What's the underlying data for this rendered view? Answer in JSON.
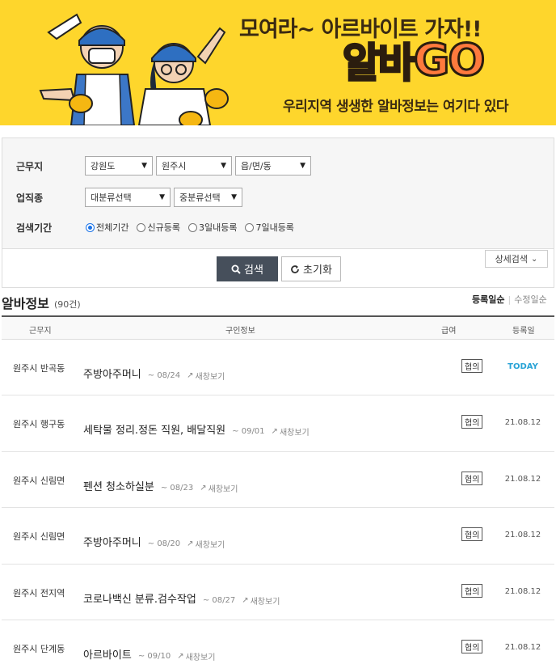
{
  "banner": {
    "slogan": "모여라~ 아르바이트 가자!!",
    "logo_kr": "알바",
    "logo_en": "GO",
    "tagline": "우리지역 생생한 알바정보는 여기다 있다"
  },
  "search": {
    "work_area_label": "근무지",
    "province": "강원도",
    "city": "원주시",
    "town": "읍/면/동",
    "job_type_label": "업직종",
    "major_category": "대분류선택",
    "minor_category": "중분류선택",
    "period_label": "검색기간",
    "period_options": [
      "전체기간",
      "신규등록",
      "3일내등록",
      "7일내등록"
    ],
    "period_selected": 0,
    "detail_search": "상세검색",
    "search_button": "검색",
    "reset_button": "초기화"
  },
  "list": {
    "title": "알바정보",
    "count": "(90건)",
    "sort_registered": "등록일순",
    "sort_modified": "수정일순",
    "columns": [
      "근무지",
      "구인정보",
      "급여",
      "등록일"
    ],
    "new_window_label": "새창보기",
    "rows": [
      {
        "area": "원주시 반곡동",
        "job": "주방아주머니",
        "deadline": "~ 08/24",
        "pay": "협의",
        "date": "TODAY"
      },
      {
        "area": "원주시 행구동",
        "job": "세탁물 정리.정돈 직원, 배달직원",
        "deadline": "~ 09/01",
        "pay": "협의",
        "date": "21.08.12"
      },
      {
        "area": "원주시 신림면",
        "job": "펜션 청소하실분",
        "deadline": "~ 08/23",
        "pay": "협의",
        "date": "21.08.12"
      },
      {
        "area": "원주시 신림면",
        "job": "주방아주머니",
        "deadline": "~ 08/20",
        "pay": "협의",
        "date": "21.08.12"
      },
      {
        "area": "원주시 전지역",
        "job": "코로나백신 분류.검수작업",
        "deadline": "~ 08/27",
        "pay": "협의",
        "date": "21.08.12"
      },
      {
        "area": "원주시 단계동",
        "job": "아르바이트",
        "deadline": "~ 09/10",
        "pay": "협의",
        "date": "21.08.12"
      }
    ]
  }
}
